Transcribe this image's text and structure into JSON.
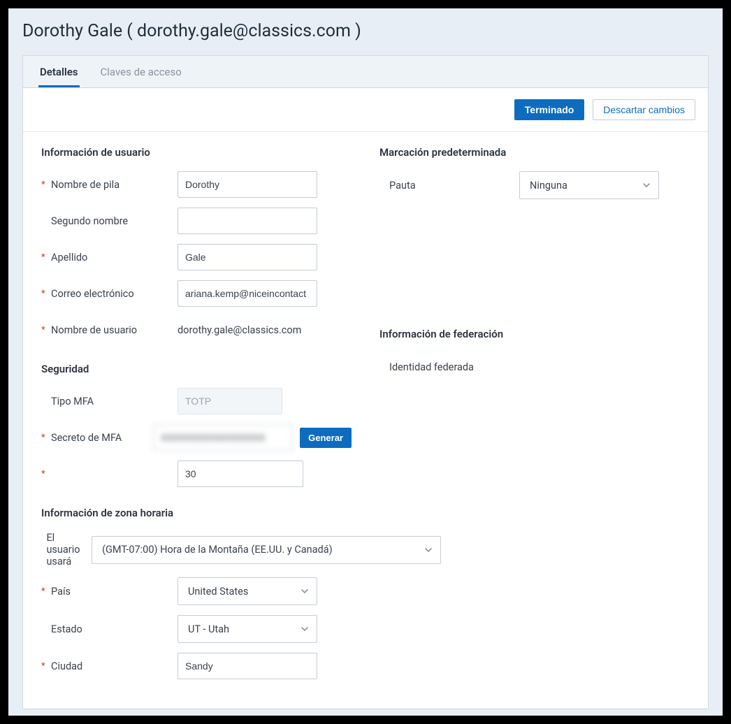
{
  "pageTitle": "Dorothy Gale ( dorothy.gale@classics.com )",
  "tabs": {
    "details": "Detalles",
    "accessKeys": "Claves de acceso"
  },
  "actions": {
    "done": "Terminado",
    "discard": "Descartar cambios"
  },
  "sections": {
    "userInfo": "Información de usuario",
    "security": "Seguridad",
    "timezone": "Información de zona horaria",
    "defaultDial": "Marcación predeterminada",
    "federation": "Información de federación"
  },
  "labels": {
    "firstName": "Nombre de pila",
    "middleName": "Segundo nombre",
    "lastName": "Apellido",
    "email": "Correo electrónico",
    "username": "Nombre de usuario",
    "mfaType": "Tipo MFA",
    "mfaSecret": "Secreto de MFA",
    "mfaInterval": "",
    "userWillUse": "El usuario usará",
    "country": "País",
    "state": "Estado",
    "city": "Ciudad",
    "pattern": "Pauta",
    "federatedIdentity": "Identidad federada"
  },
  "values": {
    "firstName": "Dorothy",
    "middleName": "",
    "lastName": "Gale",
    "email": "ariana.kemp@niceincontact",
    "username": "dorothy.gale@classics.com",
    "mfaType": "TOTP",
    "mfaSecret": "XXXXXXXXXXXXXXXX",
    "mfaInterval": "30",
    "timezone": "(GMT-07:00) Hora de la Montaña (EE.UU. y Canadá)",
    "country": "United States",
    "state": "UT - Utah",
    "city": "Sandy",
    "pattern": "Ninguna"
  },
  "buttons": {
    "generate": "Generar"
  }
}
